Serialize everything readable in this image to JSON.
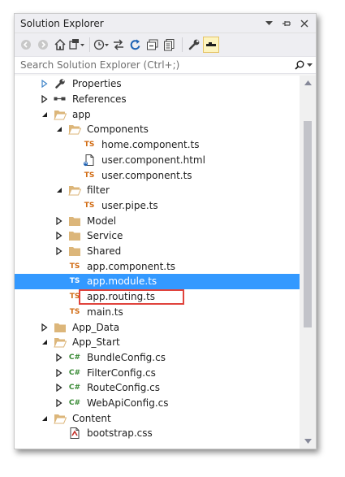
{
  "window": {
    "title": "Solution Explorer",
    "controls": [
      "dropdown-icon",
      "pin-icon",
      "close-icon"
    ]
  },
  "toolbar": {
    "buttons": [
      "back-icon",
      "forward-icon",
      "home-icon",
      "switch-views-icon",
      "history-icon",
      "sync-icon",
      "refresh-icon",
      "collapse-all-icon",
      "show-all-files-icon",
      "properties-icon",
      "preview-icon"
    ]
  },
  "search": {
    "placeholder": "Search Solution Explorer (Ctrl+;)"
  },
  "tree": {
    "rows": [
      {
        "label": "Properties",
        "expander": "collapsed",
        "icon": "wrench"
      },
      {
        "label": "References",
        "expander": "collapsed",
        "icon": "references"
      },
      {
        "label": "app",
        "expander": "expanded",
        "icon": "folder-open"
      },
      {
        "label": "Components",
        "expander": "expanded",
        "icon": "folder-open"
      },
      {
        "label": "home.component.ts",
        "expander": "none",
        "icon": "ts"
      },
      {
        "label": "user.component.html",
        "expander": "none",
        "icon": "html"
      },
      {
        "label": "user.component.ts",
        "expander": "none",
        "icon": "ts"
      },
      {
        "label": "filter",
        "expander": "expanded",
        "icon": "folder-open"
      },
      {
        "label": "user.pipe.ts",
        "expander": "none",
        "icon": "ts"
      },
      {
        "label": "Model",
        "expander": "collapsed",
        "icon": "folder"
      },
      {
        "label": "Service",
        "expander": "collapsed",
        "icon": "folder"
      },
      {
        "label": "Shared",
        "expander": "collapsed",
        "icon": "folder"
      },
      {
        "label": "app.component.ts",
        "expander": "none",
        "icon": "ts"
      },
      {
        "label": "app.module.ts",
        "expander": "none",
        "icon": "ts",
        "selected": true
      },
      {
        "label": "app.routing.ts",
        "expander": "none",
        "icon": "ts"
      },
      {
        "label": "main.ts",
        "expander": "none",
        "icon": "ts"
      },
      {
        "label": "App_Data",
        "expander": "collapsed",
        "icon": "folder"
      },
      {
        "label": "App_Start",
        "expander": "expanded",
        "icon": "folder-open"
      },
      {
        "label": "BundleConfig.cs",
        "expander": "collapsed",
        "icon": "cs"
      },
      {
        "label": "FilterConfig.cs",
        "expander": "collapsed",
        "icon": "cs"
      },
      {
        "label": "RouteConfig.cs",
        "expander": "collapsed",
        "icon": "cs"
      },
      {
        "label": "WebApiConfig.cs",
        "expander": "collapsed",
        "icon": "cs"
      },
      {
        "label": "Content",
        "expander": "expanded",
        "icon": "folder-open"
      },
      {
        "label": "bootstrap.css",
        "expander": "none",
        "icon": "css"
      }
    ],
    "icon_text": {
      "ts": "TS",
      "cs": "C#"
    }
  },
  "colors": {
    "selection": "#3399ff",
    "highlight_box": "#e0433c",
    "ts_icon": "#d16b13",
    "cs_icon": "#388a34",
    "folder": "#dcb67a"
  }
}
